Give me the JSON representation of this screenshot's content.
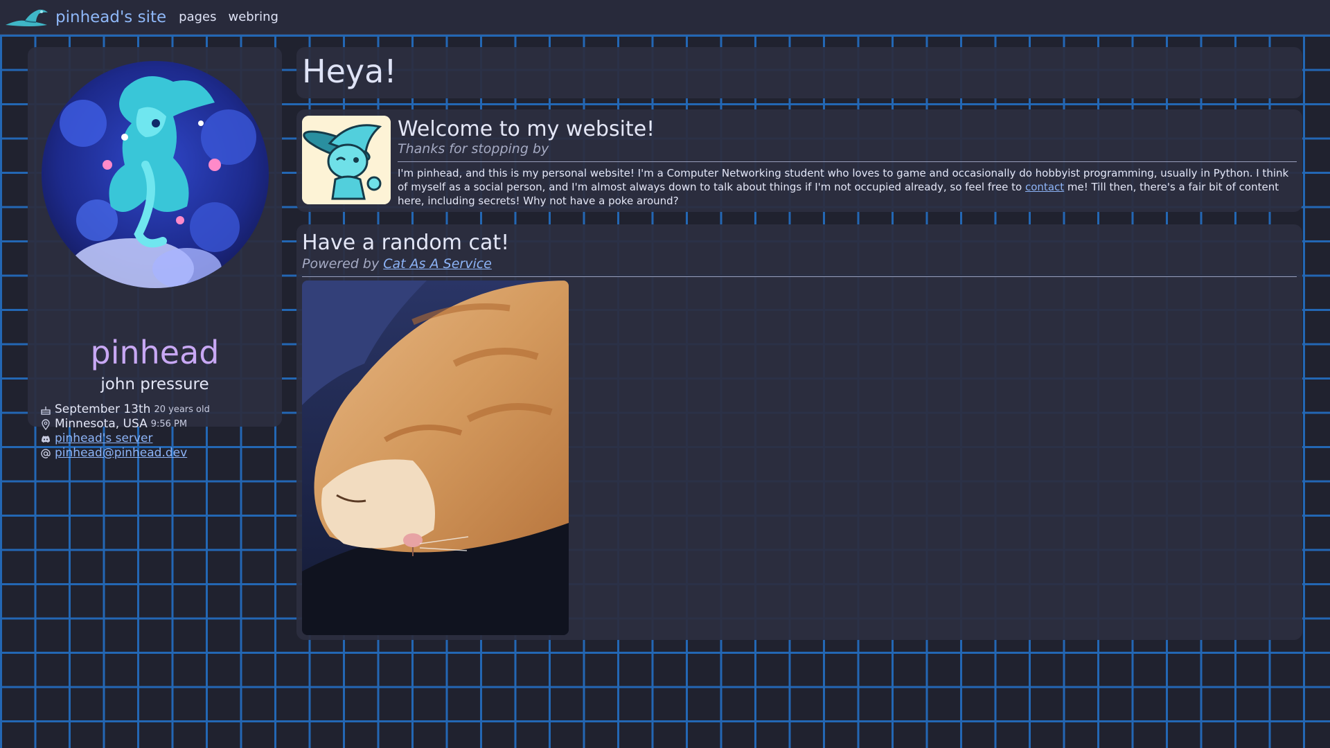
{
  "nav": {
    "logo_icon": "wizard-hat-icon",
    "site_title": "pinhead's site",
    "links": [
      "pages",
      "webring"
    ]
  },
  "profile": {
    "avatar_icon": "character-portrait",
    "name": "pinhead",
    "real_name": "john pressure",
    "birthday": "September 13th",
    "age": "20 years old",
    "location": "Minnesota, USA",
    "local_time": "9:56 PM",
    "discord_label": "pinhead's server",
    "email": "pinhead@pinhead.dev",
    "icons": {
      "birthday": "cake-icon",
      "location": "map-pin-icon",
      "discord": "discord-icon",
      "email": "at-icon"
    }
  },
  "heya": {
    "title": "Heya!"
  },
  "welcome": {
    "title": "Welcome to my website!",
    "subtitle": "Thanks for stopping by",
    "body_before": "I'm pinhead, and this is my personal website! I'm a Computer Networking student who loves to game and occasionally do hobbyist programming, usually in Python. I think of myself as a social person, and I'm almost always down to talk about things if I'm not occupied already, so feel free to ",
    "body_link": "contact",
    "body_after": " me! Till then, there's a fair bit of content here, including secrets! Why not have a poke around?"
  },
  "cat": {
    "title": "Have a random cat!",
    "subtitle_prefix": "Powered by ",
    "subtitle_link": "Cat As A Service"
  },
  "colors": {
    "grid_line": "#2367b4",
    "background": "#20222f",
    "panel": "#2c2e40",
    "accent_name": "#c8a8f4",
    "link": "#8db4f7"
  }
}
